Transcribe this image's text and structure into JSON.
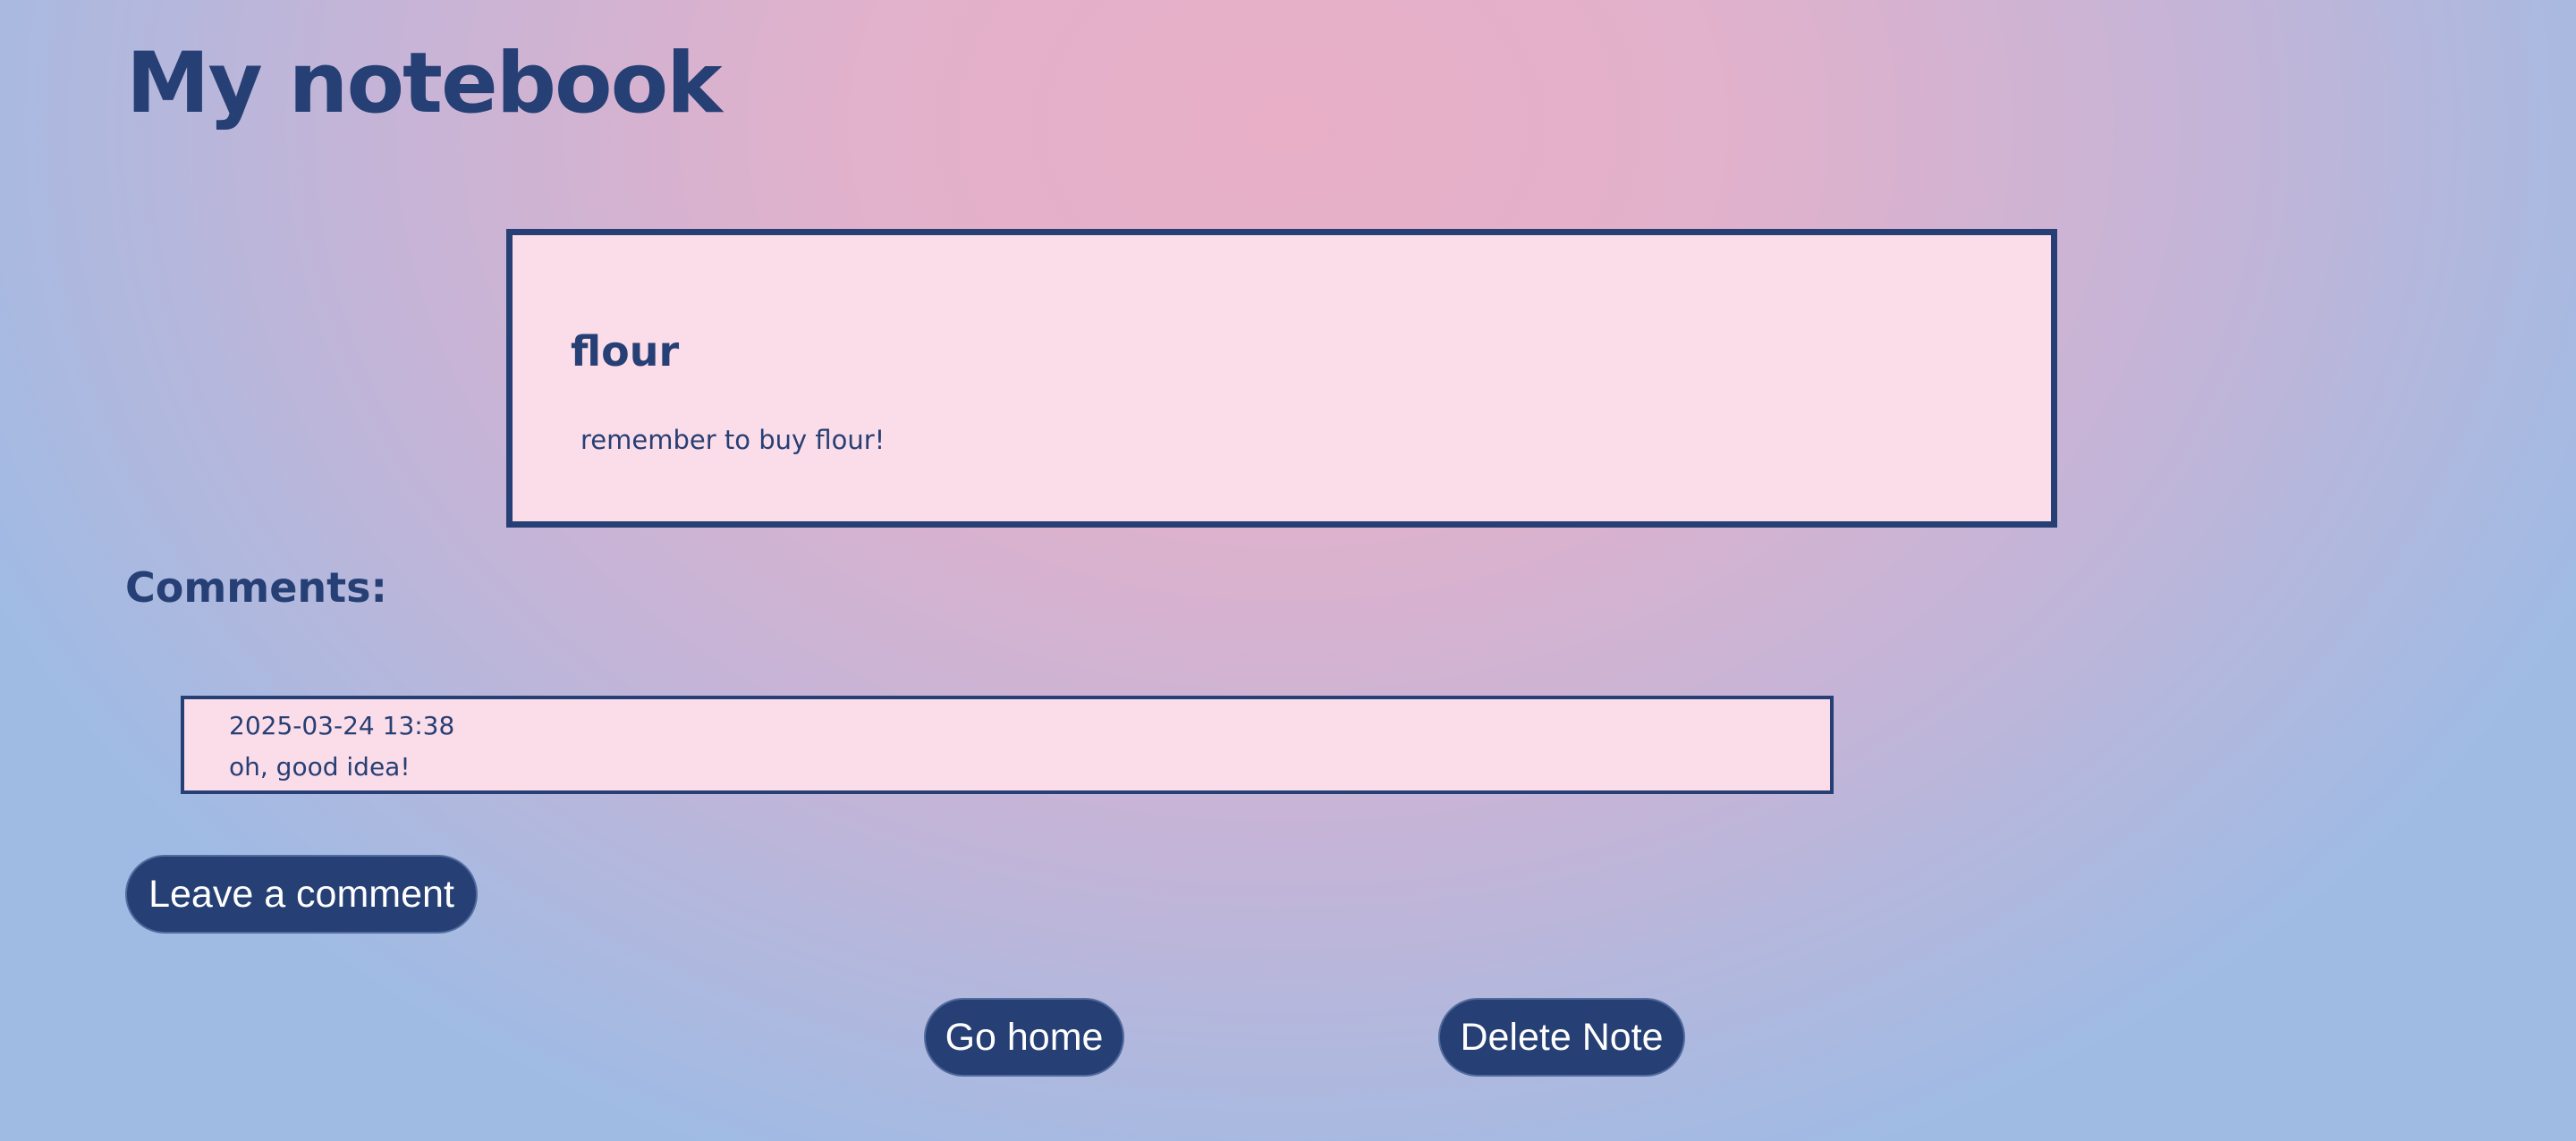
{
  "header": {
    "title": "My notebook"
  },
  "note": {
    "title": "flour",
    "body": "remember to buy flour!"
  },
  "comments": {
    "heading": "Comments:",
    "items": [
      {
        "timestamp": "2025-03-24 13:38",
        "text": "oh, good idea!"
      }
    ]
  },
  "actions": {
    "leave_comment_label": "Leave a comment",
    "go_home_label": "Go home",
    "delete_note_label": "Delete Note"
  },
  "colors": {
    "primary": "#263f74",
    "card_background": "#fbdce9",
    "button_text": "#ffffff",
    "background_center": "#e8afc7",
    "background_edge": "#9fbbe4"
  }
}
